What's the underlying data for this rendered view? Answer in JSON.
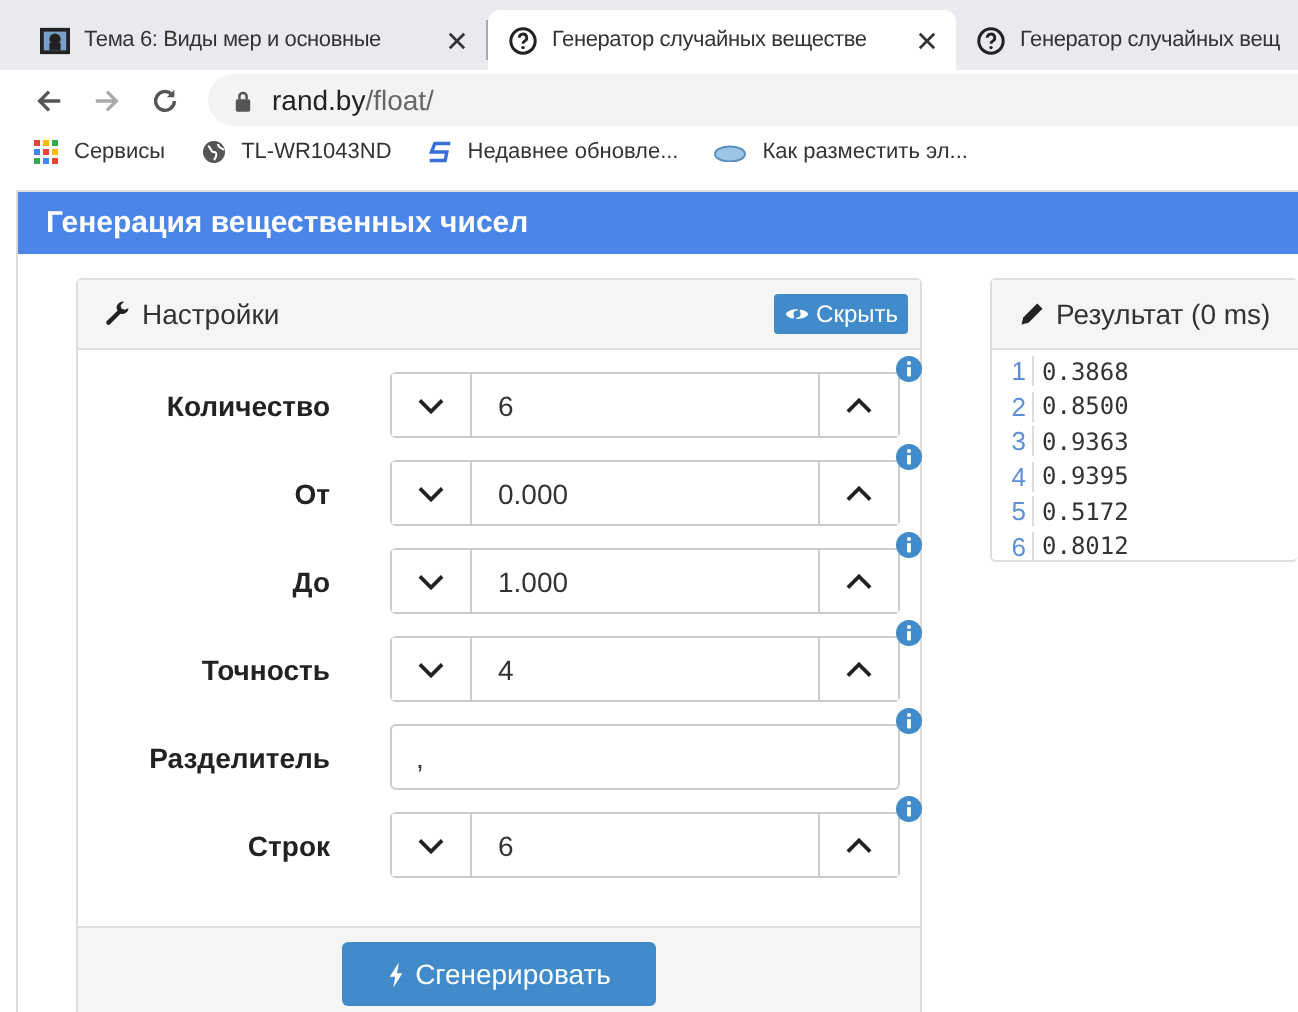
{
  "browser": {
    "tabs": [
      {
        "title": "Тема 6: Виды мер и основные",
        "selected": false,
        "kind": "picture",
        "closable": true
      },
      {
        "title": "Генератор случайных веществе",
        "selected": true,
        "kind": "help",
        "closable": true
      },
      {
        "title": "Генератор случайных вещ",
        "selected": false,
        "kind": "help",
        "closable": false
      }
    ],
    "address": {
      "host": "rand.by",
      "path": "/float/"
    },
    "bookmarks": [
      {
        "label": "Сервисы",
        "kind": "apps"
      },
      {
        "label": "TL-WR1043ND",
        "kind": "globe"
      },
      {
        "label": "Недавнее обновле...",
        "kind": "s-logo"
      },
      {
        "label": "Как разместить эл...",
        "kind": "cloud"
      }
    ]
  },
  "page": {
    "title": "Генерация вещественных чисел",
    "settings": {
      "title": "Настройки",
      "hide_button": "Скрыть",
      "fields": [
        {
          "label": "Количество",
          "value": "6",
          "kind": "spinner"
        },
        {
          "label": "От",
          "value": "0.000",
          "kind": "spinner"
        },
        {
          "label": "До",
          "value": "1.000",
          "kind": "spinner"
        },
        {
          "label": "Точность",
          "value": "4",
          "kind": "spinner"
        },
        {
          "label": "Разделитель",
          "value": ",",
          "kind": "text"
        },
        {
          "label": "Строк",
          "value": "6",
          "kind": "spinner"
        }
      ],
      "generate_button": "Сгенерировать"
    },
    "result": {
      "title": "Результат (0 ms)",
      "lines": [
        {
          "number": "1",
          "value": "0.3868"
        },
        {
          "number": "2",
          "value": "0.8500"
        },
        {
          "number": "3",
          "value": "0.9363"
        },
        {
          "number": "4",
          "value": "0.9395"
        },
        {
          "number": "5",
          "value": "0.5172"
        },
        {
          "number": "6",
          "value": "0.8012"
        }
      ]
    }
  }
}
